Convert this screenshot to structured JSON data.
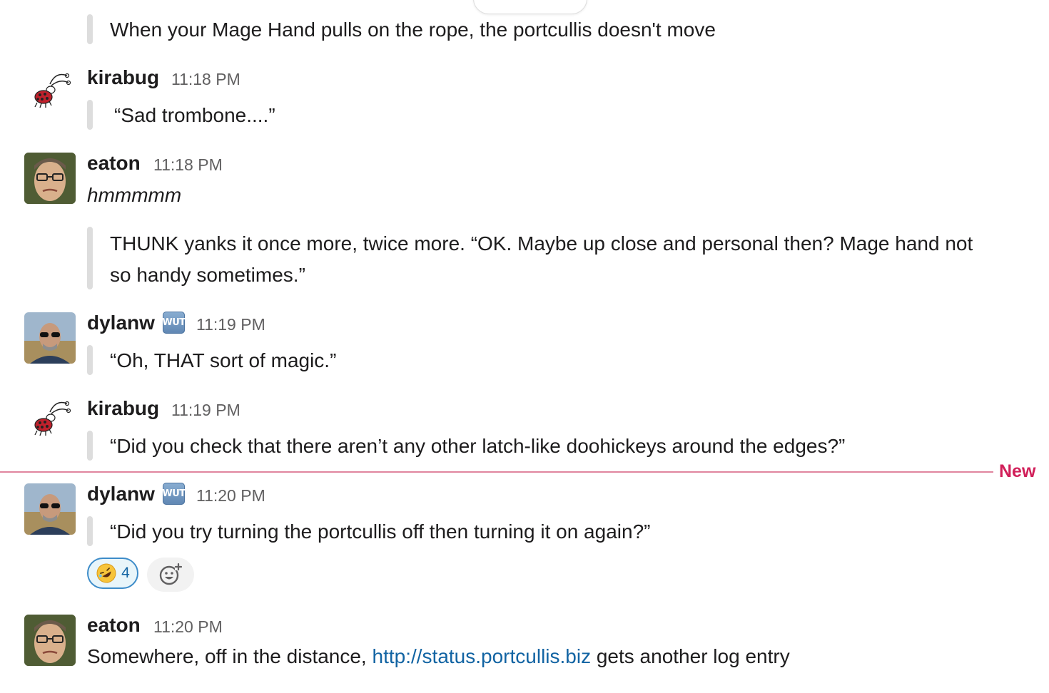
{
  "new_marker": "New",
  "messages": [
    {
      "quote": "When your Mage Hand pulls on the rope, the portcullis doesn't move"
    },
    {
      "user": "kirabug",
      "time": "11:18 PM",
      "quote": "“Sad trombone....”"
    },
    {
      "user": "eaton",
      "time": "11:18 PM",
      "text": "hmmmmm",
      "quote_line1": "THUNK yanks it once more, twice more. “OK. Maybe up close and personal then? Mage hand not",
      "quote_line2": "so handy sometimes.”"
    },
    {
      "user": "dylanw",
      "badge": "WUT",
      "time": "11:19 PM",
      "quote": "“Oh, THAT sort of magic.”"
    },
    {
      "user": "kirabug",
      "time": "11:19 PM",
      "quote": "“Did you check that there aren’t any other latch-like doohickeys around the edges?”"
    },
    {
      "user": "dylanw",
      "badge": "WUT",
      "time": "11:20 PM",
      "quote": "“Did you try turning the portcullis off then turning it on again?”",
      "reaction": {
        "emoji": "rolling-on-floor-laughing",
        "count": "4"
      }
    },
    {
      "user": "eaton",
      "time": "11:20 PM",
      "text_before": "Somewhere, off in the distance, ",
      "link": "http://status.portcullis.biz",
      "text_after": " gets another log entry"
    }
  ]
}
